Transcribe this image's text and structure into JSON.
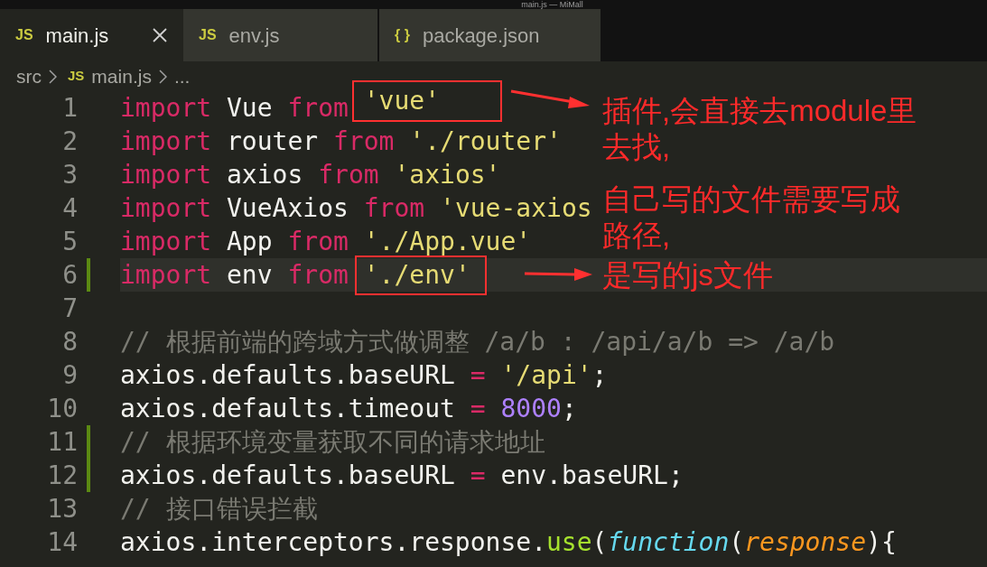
{
  "window": {
    "title": "main.js — MiMall"
  },
  "tabs": [
    {
      "icon": "JS",
      "label": "main.js",
      "selected": true,
      "closable": true
    },
    {
      "icon": "JS",
      "label": "env.js",
      "selected": false,
      "closable": false
    },
    {
      "icon": "{ }",
      "label": "package.json",
      "selected": false,
      "closable": false
    }
  ],
  "breadcrumb": [
    {
      "text": "src"
    },
    {
      "icon": "JS",
      "text": "main.js"
    },
    {
      "text": "..."
    }
  ],
  "code_lines": [
    {
      "number": "1",
      "modified": false,
      "current": false,
      "tokens": [
        {
          "kind": "kw",
          "text": "import"
        },
        {
          "kind": "id",
          "text": " Vue "
        },
        {
          "kind": "kw",
          "text": "from "
        },
        {
          "kind": "str",
          "text": "'vue'",
          "highlighted": true
        }
      ]
    },
    {
      "number": "2",
      "modified": false,
      "current": false,
      "tokens": [
        {
          "kind": "kw",
          "text": "import"
        },
        {
          "kind": "id",
          "text": " router "
        },
        {
          "kind": "kw",
          "text": "from "
        },
        {
          "kind": "str",
          "text": "'./router'"
        }
      ]
    },
    {
      "number": "3",
      "modified": false,
      "current": false,
      "tokens": [
        {
          "kind": "kw",
          "text": "import"
        },
        {
          "kind": "id",
          "text": " axios "
        },
        {
          "kind": "kw",
          "text": "from "
        },
        {
          "kind": "str",
          "text": "'axios'"
        }
      ]
    },
    {
      "number": "4",
      "modified": false,
      "current": false,
      "tokens": [
        {
          "kind": "kw",
          "text": "import"
        },
        {
          "kind": "id",
          "text": " VueAxios "
        },
        {
          "kind": "kw",
          "text": "from "
        },
        {
          "kind": "str",
          "text": "'vue-axios"
        }
      ]
    },
    {
      "number": "5",
      "modified": false,
      "current": false,
      "tokens": [
        {
          "kind": "kw",
          "text": "import"
        },
        {
          "kind": "id",
          "text": " App "
        },
        {
          "kind": "kw",
          "text": "from "
        },
        {
          "kind": "str",
          "text": "'./App.vue'"
        }
      ]
    },
    {
      "number": "6",
      "modified": true,
      "current": true,
      "tokens": [
        {
          "kind": "kw",
          "text": "import"
        },
        {
          "kind": "id",
          "text": " env "
        },
        {
          "kind": "kw",
          "text": "from "
        },
        {
          "kind": "str",
          "text": "'./env'",
          "highlighted": true
        }
      ]
    },
    {
      "number": "7",
      "modified": false,
      "current": false
    },
    {
      "number": "8",
      "modified": false,
      "current": false,
      "tokens": [
        {
          "kind": "comment",
          "text": "// 根据前端的跨域方式做调整 /a/b : /api/a/b => /a/b"
        }
      ]
    },
    {
      "number": "9",
      "modified": false,
      "current": false,
      "tokens": [
        {
          "kind": "id",
          "text": "axios.defaults.baseURL "
        },
        {
          "kind": "kw",
          "text": "= "
        },
        {
          "kind": "str",
          "text": "'/api'"
        },
        {
          "kind": "id",
          "text": ";"
        }
      ]
    },
    {
      "number": "10",
      "modified": false,
      "current": false,
      "tokens": [
        {
          "kind": "id",
          "text": "axios.defaults.timeout "
        },
        {
          "kind": "kw",
          "text": "= "
        },
        {
          "kind": "num",
          "text": "8000"
        },
        {
          "kind": "id",
          "text": ";"
        }
      ]
    },
    {
      "number": "11",
      "modified": true,
      "current": false,
      "tokens": [
        {
          "kind": "comment",
          "text": "// 根据环境变量获取不同的请求地址"
        }
      ]
    },
    {
      "number": "12",
      "modified": true,
      "current": false,
      "tokens": [
        {
          "kind": "id",
          "text": "axios.defaults.baseURL "
        },
        {
          "kind": "kw",
          "text": "="
        },
        {
          "kind": "id",
          "text": " env.baseURL;"
        }
      ]
    },
    {
      "number": "13",
      "modified": false,
      "current": false,
      "tokens": [
        {
          "kind": "comment",
          "text": "// 接口错误拦截"
        }
      ]
    },
    {
      "number": "14",
      "modified": false,
      "current": false,
      "tokens": [
        {
          "kind": "id",
          "text": "axios.interceptors.response."
        },
        {
          "kind": "func",
          "text": "use"
        },
        {
          "kind": "id",
          "text": "("
        },
        {
          "kind": "storage",
          "text": "function"
        },
        {
          "kind": "id",
          "text": "("
        },
        {
          "kind": "param",
          "text": "response"
        },
        {
          "kind": "id",
          "text": "){"
        }
      ]
    }
  ],
  "annotations": [
    {
      "lines": [
        "插件,会直接去module里",
        "去找,"
      ]
    },
    {
      "lines": [
        "自己写的文件需要写成",
        "路径,"
      ]
    },
    {
      "lines": [
        "是写的js文件"
      ]
    }
  ]
}
